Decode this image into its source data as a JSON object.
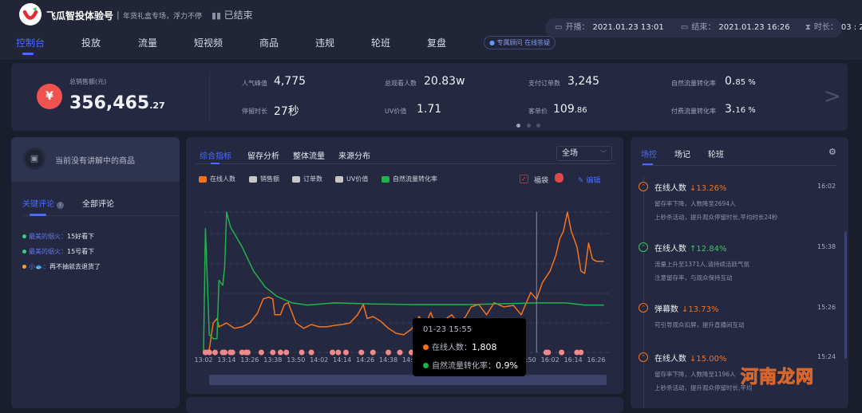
{
  "header": {
    "account_name": "飞瓜智投体验号",
    "separator": "|",
    "subtitle": "年货礼盒专场，浮力不停",
    "status": "已结束",
    "nav_tabs": [
      "控制台",
      "投放",
      "流量",
      "短视频",
      "商品",
      "违规",
      "轮班",
      "复盘"
    ],
    "active_tab": "控制台",
    "consultant_pill": "专属顾问 在线答疑",
    "start_label": "开播：",
    "start_value": "2021.01.23 13:01",
    "end_label": "结束：",
    "end_value": "2021.01.23 16:26",
    "duration_label": "时长：",
    "duration_value": "03 : 25"
  },
  "stats": {
    "total_sales_label": "总销售额(元)",
    "total_sales_int": "356,465",
    "total_sales_dec": ".27",
    "currency_icon": "¥",
    "items": [
      {
        "label": "人气峰值",
        "value": "4,775"
      },
      {
        "label": "停留时长",
        "value": "27秒"
      },
      {
        "label": "总观看人数",
        "value": "20.83w"
      },
      {
        "label": "UV价值",
        "value": "1.71"
      },
      {
        "label": "支付订单数",
        "value": "3,245"
      },
      {
        "label": "客单价",
        "value": "109",
        "value_small": ".86"
      },
      {
        "label": "自然流量转化率",
        "value": "0.",
        "value_small": "85 %"
      },
      {
        "label": "付费流量转化率",
        "value": "3.",
        "value_small": "16 %"
      }
    ],
    "page_dots": 3,
    "active_dot": 0
  },
  "left_panel": {
    "no_product_text": "当前没有讲解中的商品",
    "tabs": [
      "关键评论",
      "全部评论"
    ],
    "active_tab": "关键评论",
    "comments": [
      {
        "user": "最美的烟火：",
        "text": "15好看下",
        "dot": "#3ec98c"
      },
      {
        "user": "最美的烟火：",
        "text": "15号看下",
        "dot": "#3ec98c"
      },
      {
        "user": "小🐟：",
        "text": "再不抽就去退货了",
        "dot": "#f0a040"
      }
    ]
  },
  "chart_panel": {
    "tabs": [
      "综合指标",
      "留存分析",
      "整体流量",
      "来源分布"
    ],
    "active_tab": "综合指标",
    "scope_select": "全场",
    "legend": [
      {
        "label": "在线人数",
        "color": "#f5731c",
        "on": true
      },
      {
        "label": "销售额",
        "color": "#c8c8c8",
        "on": false
      },
      {
        "label": "订单数",
        "color": "#c8c8c8",
        "on": false
      },
      {
        "label": "UV价值",
        "color": "#c8c8c8",
        "on": false
      },
      {
        "label": "自然流量转化率",
        "color": "#22b24c",
        "on": true
      }
    ],
    "fudai_label": "福袋",
    "fudai_checked": true,
    "edit_label": "编辑",
    "tooltip": {
      "time": "01-23 15:55",
      "rows": [
        {
          "label": "在线人数：",
          "value": "1,808",
          "color": "#f5731c"
        },
        {
          "label": "自然流量转化率：",
          "value": "0.9%",
          "color": "#22b24c"
        }
      ]
    }
  },
  "chart_data": {
    "type": "line",
    "x_ticks": [
      "13:02",
      "13:14",
      "13:26",
      "13:38",
      "13:50",
      "14:02",
      "14:14",
      "14:26",
      "14:38",
      "14:50",
      "15:02",
      "15:14",
      "15:26",
      "15:38",
      "15:50",
      "16:02",
      "16:14",
      "16:26"
    ],
    "grid": "horizontal dashed",
    "series": [
      {
        "name": "在线人数",
        "color": "#f5731c",
        "points": [
          [
            "13:02",
            0
          ],
          [
            "13:05",
            100
          ],
          [
            "13:07",
            1000
          ],
          [
            "13:09",
            1150
          ],
          [
            "13:10",
            870
          ],
          [
            "13:14",
            1000
          ],
          [
            "13:18",
            820
          ],
          [
            "13:22",
            870
          ],
          [
            "13:26",
            1000
          ],
          [
            "13:30",
            1330
          ],
          [
            "13:33",
            1820
          ],
          [
            "13:36",
            1880
          ],
          [
            "13:38",
            1820
          ],
          [
            "13:39",
            1280
          ],
          [
            "13:42",
            1280
          ],
          [
            "13:44",
            1630
          ],
          [
            "13:46",
            1690
          ],
          [
            "13:50",
            1000
          ],
          [
            "13:54",
            820
          ],
          [
            "13:58",
            950
          ],
          [
            "14:02",
            870
          ],
          [
            "14:06",
            870
          ],
          [
            "14:10",
            920
          ],
          [
            "14:14",
            950
          ],
          [
            "14:18",
            1000
          ],
          [
            "14:22",
            1280
          ],
          [
            "14:25",
            1630
          ],
          [
            "14:27",
            1150
          ],
          [
            "14:30",
            1220
          ],
          [
            "14:34",
            1060
          ],
          [
            "14:38",
            820
          ],
          [
            "14:42",
            650
          ],
          [
            "14:46",
            600
          ],
          [
            "14:50",
            790
          ],
          [
            "14:54",
            1220
          ],
          [
            "14:57",
            920
          ],
          [
            "15:00",
            1360
          ],
          [
            "15:03",
            870
          ],
          [
            "15:08",
            1150
          ],
          [
            "15:11",
            1280
          ],
          [
            "15:14",
            1000
          ],
          [
            "15:18",
            1200
          ],
          [
            "15:21",
            1550
          ],
          [
            "15:25",
            1630
          ],
          [
            "15:29",
            1280
          ],
          [
            "15:33",
            1690
          ],
          [
            "15:38",
            1550
          ],
          [
            "15:43",
            1600
          ],
          [
            "15:47",
            1280
          ],
          [
            "15:52",
            2040
          ],
          [
            "15:55",
            1808
          ],
          [
            "15:58",
            2370
          ],
          [
            "16:02",
            2770
          ],
          [
            "16:05",
            3300
          ],
          [
            "16:07",
            3860
          ],
          [
            "16:09",
            4130
          ],
          [
            "16:11",
            4775
          ],
          [
            "16:13",
            4130
          ],
          [
            "16:16",
            3590
          ],
          [
            "16:18",
            2770
          ],
          [
            "16:20",
            2690
          ],
          [
            "16:22",
            3720
          ],
          [
            "16:24",
            3180
          ],
          [
            "16:26",
            3100
          ],
          [
            "16:30",
            3100
          ]
        ]
      },
      {
        "name": "自然流量转化率",
        "color": "#22b24c",
        "unit": "%",
        "points": [
          [
            "13:02",
            0
          ],
          [
            "13:03",
            2.25
          ],
          [
            "13:05",
            0.32
          ],
          [
            "13:07",
            0.25
          ],
          [
            "13:09",
            0.25
          ],
          [
            "13:10",
            1.31
          ],
          [
            "13:12",
            1.22
          ],
          [
            "13:13",
            1.55
          ],
          [
            "13:14",
            2.55
          ],
          [
            "13:16",
            2.28
          ],
          [
            "13:22",
            1.92
          ],
          [
            "13:28",
            1.48
          ],
          [
            "13:34",
            1.19
          ],
          [
            "13:40",
            1.02
          ],
          [
            "13:48",
            0.9
          ],
          [
            "13:56",
            0.86
          ],
          [
            "14:10",
            0.9
          ],
          [
            "14:30",
            0.88
          ],
          [
            "14:50",
            0.87
          ],
          [
            "15:20",
            0.87
          ],
          [
            "15:55",
            0.9
          ],
          [
            "16:10",
            0.9
          ],
          [
            "16:20",
            0.86
          ],
          [
            "16:30",
            0.86
          ]
        ]
      }
    ],
    "fudai_markers": [
      "13:03",
      "13:05",
      "13:08",
      "13:12",
      "13:13",
      "13:16",
      "13:17",
      "13:22",
      "13:24",
      "13:25",
      "13:32",
      "13:38",
      "13:42",
      "13:45",
      "13:53",
      "13:58",
      "14:09",
      "14:12",
      "14:16",
      "14:24",
      "14:30",
      "14:38",
      "14:44",
      "14:50",
      "14:56",
      "15:03",
      "15:10",
      "15:16",
      "15:22",
      "15:30",
      "15:36",
      "15:42",
      "15:48",
      "16:00",
      "16:01",
      "16:08",
      "16:16",
      "16:18"
    ],
    "ylim_online": [
      0,
      4775
    ],
    "ylim_rate": [
      0,
      2.55
    ]
  },
  "right_panel": {
    "tabs": [
      "场控",
      "场记",
      "轮班"
    ],
    "active_tab": "场控",
    "events": [
      {
        "title": "在线人数",
        "change": "↓13.26%",
        "trend": "down",
        "time": "16:02",
        "details": [
          "留存率下降，人数降至2694人",
          "上秒杀活动，提升观众停留时长,平均时长24秒"
        ]
      },
      {
        "title": "在线人数",
        "change": "↑12.84%",
        "trend": "up",
        "time": "15:38",
        "details": [
          "流量上升至1371人,请持续活跃气氛",
          "注意留存率，与观众保持互动"
        ]
      },
      {
        "title": "弹幕数",
        "change": "↓13.73%",
        "trend": "down",
        "time": "15:26",
        "details": [
          "可引导观众扣屏，提升直播间互动"
        ]
      },
      {
        "title": "在线人数",
        "change": "↓15.00%",
        "trend": "down",
        "time": "15:24",
        "details": [
          "留存率下降，人数降至1196人",
          "上秒杀活动，提升观众停留时长,平均"
        ]
      }
    ],
    "colors": {
      "down": "#f5731c",
      "up": "#3ec95c"
    }
  },
  "watermark": "河南龙网"
}
